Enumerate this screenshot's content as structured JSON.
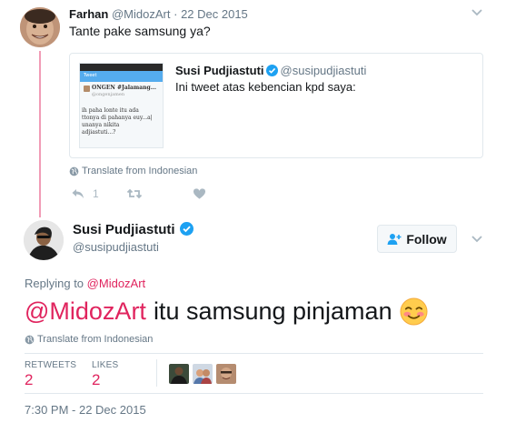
{
  "quoted_reply": {
    "author_name": "Farhan",
    "author_handle": "@MidozArt",
    "date": "22 Dec 2015",
    "text": "Tante pake samsung ya?",
    "reply_count": "1",
    "translate_label": "Translate from Indonesian"
  },
  "embedded_quote": {
    "author_name": "Susi Pudjiastuti",
    "author_handle": "@susipudjiastuti",
    "text": "Ini tweet atas kebencian kpd saya:",
    "thumb_lines": [
      "ONGEN #Jalamang...",
      "@ongenjamen",
      "ih paha lonte itu ada",
      "ttonya di pahanya euy...a|",
      "unanya nikita",
      "adjiastuti...?"
    ]
  },
  "main_tweet": {
    "author_name": "Susi Pudjiastuti",
    "author_handle": "@susipudjiastuti",
    "follow_label": "Follow",
    "replying_prefix": "Replying to",
    "replying_to": "@MidozArt",
    "mention": "@MidozArt",
    "text": "itu samsung pinjaman",
    "translate_label": "Translate from Indonesian",
    "retweets_label": "RETWEETS",
    "retweets_count": "2",
    "likes_label": "LIKES",
    "likes_count": "2",
    "timestamp": "7:30 PM - 22 Dec 2015"
  },
  "colors": {
    "accent": "#e0245e",
    "verified": "#1da1f2",
    "muted": "#657786",
    "border": "#e1e8ed"
  }
}
